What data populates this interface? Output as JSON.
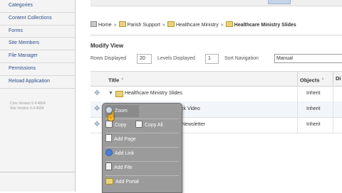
{
  "sidebar": {
    "items": [
      {
        "label": "Categories"
      },
      {
        "label": "Content Collections"
      },
      {
        "label": "Forms"
      },
      {
        "label": "Site Members"
      },
      {
        "label": "File Manager"
      },
      {
        "label": "Permissions"
      },
      {
        "label": "Reload Application"
      }
    ],
    "core_version": "Core Version 5.4.4664",
    "site_version": "Site Version 5.4.4664"
  },
  "breadcrumb": {
    "items": [
      "Home",
      "Parish Support",
      "Healthcare Ministry"
    ],
    "current": "Healthcare Ministry Slides",
    "separator": "»"
  },
  "view": {
    "title": "Modify View",
    "rows_label": "Rows Displayed",
    "rows_value": "20",
    "levels_label": "Levels Displayed",
    "levels_value": "1",
    "sort_label": "Sort Navigation",
    "sort_value": "Manual"
  },
  "table": {
    "columns": [
      "Title",
      "Objects",
      "Di"
    ],
    "rows": [
      {
        "title": "Healthcare Ministry Slides",
        "objects": "Inherit"
      },
      {
        "title": "ck Video",
        "objects": "Inherit"
      },
      {
        "title": "Newsletter",
        "objects": "Inherit"
      }
    ]
  },
  "context_menu": {
    "items": [
      {
        "label": "Zoom",
        "icon": "zoom-icon"
      },
      {
        "label": "Copy",
        "icon": "copy-icon"
      },
      {
        "label": "Copy All",
        "icon": "copy-icon"
      },
      {
        "label": "Add Page",
        "icon": "page-icon"
      },
      {
        "label": "Add Link",
        "icon": "link-icon"
      },
      {
        "label": "Add File",
        "icon": "file-icon"
      },
      {
        "label": "Add Portal",
        "icon": "folder-icon"
      }
    ]
  }
}
